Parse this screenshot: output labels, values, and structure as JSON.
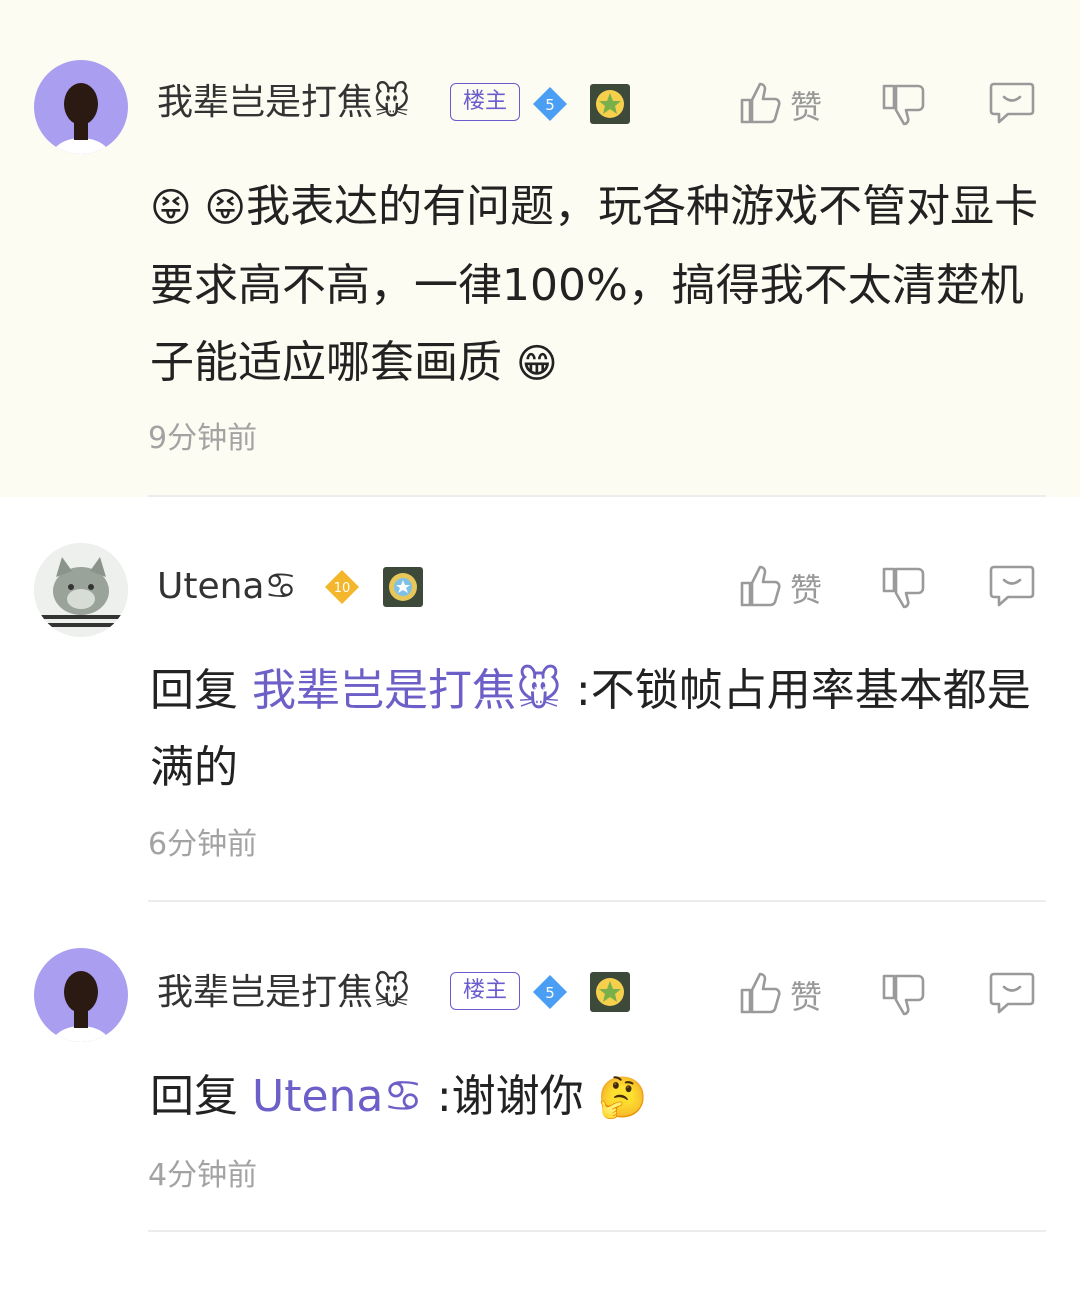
{
  "comments": [
    {
      "author": "我辈岂是打焦🐭",
      "host_badge": "楼主",
      "level": "5",
      "like_label": "赞",
      "body": "我表达的有问题，玩各种游戏不管对显卡要求高不高，一律100%，搞得我不太清楚机子能适应哪套画质",
      "lead_emoji": "😝 😝",
      "trail_emoji": "😁",
      "time": "9分钟前"
    },
    {
      "author": "Utena♋",
      "level": "10",
      "like_label": "赞",
      "reply_prefix": "回复",
      "reply_to": "我辈岂是打焦🐭",
      "body": ":不锁帧占用率基本都是满的",
      "time": "6分钟前"
    },
    {
      "author": "我辈岂是打焦🐭",
      "host_badge": "楼主",
      "level": "5",
      "like_label": "赞",
      "reply_prefix": "回复",
      "reply_to": "Utena♋",
      "body": ":谢谢你",
      "trail_emoji": "🤔",
      "time": "4分钟前"
    }
  ],
  "colors": {
    "accent": "#6c5fc7",
    "highlight_bg": "#fdfcf2",
    "level_blue": "#4a9ff5",
    "level_gold": "#f4b62a"
  }
}
